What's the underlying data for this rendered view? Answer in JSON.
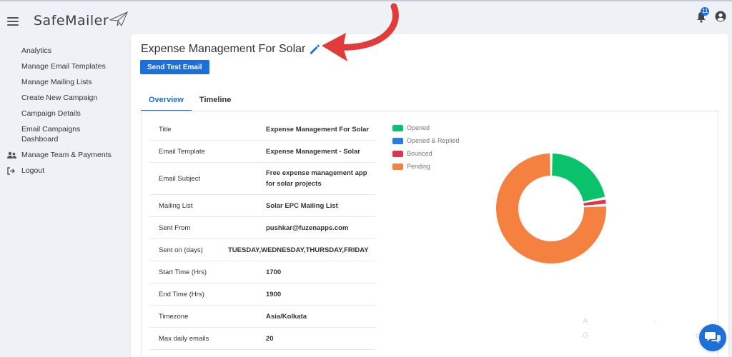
{
  "app": {
    "logo_text": "SafeMailer",
    "notification_count": "11"
  },
  "sidebar": {
    "items": [
      {
        "label": "Analytics"
      },
      {
        "label": "Manage Email Templates"
      },
      {
        "label": "Manage Mailing Lists"
      },
      {
        "label": "Create New Campaign"
      },
      {
        "label": "Campaign Details"
      },
      {
        "label": "Email Campaigns",
        "label2": "Dashboard"
      },
      {
        "label": "Manage Team & Payments",
        "icon": "team-icon"
      },
      {
        "label": "Logout",
        "icon": "logout-icon"
      }
    ]
  },
  "campaign": {
    "title": "Expense Management For Solar",
    "send_test_label": "Send Test Email"
  },
  "tabs": [
    {
      "label": "Overview",
      "active": true
    },
    {
      "label": "Timeline",
      "active": false
    }
  ],
  "details": [
    {
      "key": "Title",
      "value": "Expense Management For Solar"
    },
    {
      "key": "Email Template",
      "value": "Expense Management - Solar"
    },
    {
      "key": "Email Subject",
      "value": "Free expense management app for solar projects"
    },
    {
      "key": "Mailing List",
      "value": "Solar EPC Mailing List"
    },
    {
      "key": "Sent From",
      "value": "pushkar@fuzenapps.com"
    },
    {
      "key": "Sent on (days)",
      "value": "TUESDAY,WEDNESDAY,THURSDAY,FRIDAY"
    },
    {
      "key": "Start Time (Hrs)",
      "value": "1700"
    },
    {
      "key": "End Time (Hrs)",
      "value": "1900"
    },
    {
      "key": "Timezone",
      "value": "Asia/Kolkata"
    },
    {
      "key": "Max daily emails",
      "value": "20"
    }
  ],
  "colors": {
    "accent": "#1e6fd9",
    "opened": "#0ac26b",
    "opened_replied": "#2a7be4",
    "bounced": "#e0344e",
    "pending": "#f58140",
    "annotation_arrow": "#e23b3b"
  },
  "chart_data": {
    "type": "pie",
    "donut": true,
    "legend_position": "top-left",
    "categories": [
      "Opened",
      "Opened & Replied",
      "Bounced",
      "Pending"
    ],
    "values": [
      22,
      0,
      2,
      76
    ],
    "colors": [
      "#0ac26b",
      "#2a7be4",
      "#e0344e",
      "#f58140"
    ]
  }
}
